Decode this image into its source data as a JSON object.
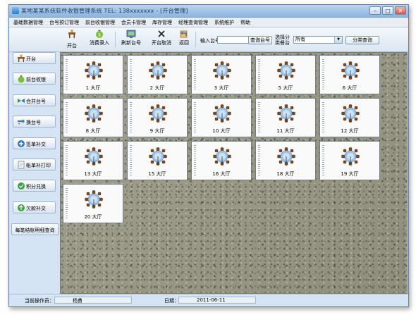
{
  "window": {
    "title": "某地某某系统软件收银管理系统 TEL: 138xxxxxxx  -  [开台管理]"
  },
  "menu": [
    "基础数据管理",
    "台号预订管理",
    "前台收银管理",
    "会员卡管理",
    "库存管理",
    "经理查询管理",
    "系统维护",
    "帮助"
  ],
  "toolbar": {
    "buttons": [
      {
        "label": "开台",
        "icon": "open-table-icon"
      },
      {
        "label": "消费录入",
        "icon": "consumption-entry-icon"
      },
      {
        "label": "刷新台号",
        "icon": "refresh-table-icon"
      },
      {
        "label": "开台取消",
        "icon": "cancel-open-icon"
      },
      {
        "label": "返回",
        "icon": "return-icon"
      }
    ],
    "table_no_label": "输入台号",
    "table_no_value": "",
    "query_button": "查询台号",
    "category_label_1": "选择分",
    "category_label_2": "类餐台",
    "category_value": "所有",
    "category_query_button": "分类查询"
  },
  "sidebar": {
    "items": [
      {
        "label": "开台",
        "icon": "open-table-icon"
      },
      {
        "label": "前台收银",
        "icon": "cashier-icon"
      },
      {
        "label": "合并台号",
        "icon": "merge-table-icon"
      },
      {
        "label": "换台号",
        "icon": "swap-table-icon"
      },
      {
        "label": "签单补交",
        "icon": "signed-bill-icon"
      },
      {
        "label": "帐单补打印",
        "icon": "reprint-bill-icon"
      },
      {
        "label": "积分兑换",
        "icon": "points-exchange-icon"
      },
      {
        "label": "欠款补交",
        "icon": "debt-payment-icon"
      },
      {
        "label": "每笔结帐明细查询",
        "icon": ""
      }
    ]
  },
  "tables": [
    "1 大厅",
    "2 大厅",
    "3 大厅",
    "5 大厅",
    "6 大厅",
    "8 大厅",
    "9 大厅",
    "10 大厅",
    "11 大厅",
    "12 大厅",
    "13 大厅",
    "15 大厅",
    "16 大厅",
    "18 大厅",
    "19 大厅",
    "20 大厅"
  ],
  "status": {
    "operator_label": "当前操作员：",
    "operator_value": "杨勇",
    "date_label": "日期：",
    "date_value": "2011-06-11"
  }
}
